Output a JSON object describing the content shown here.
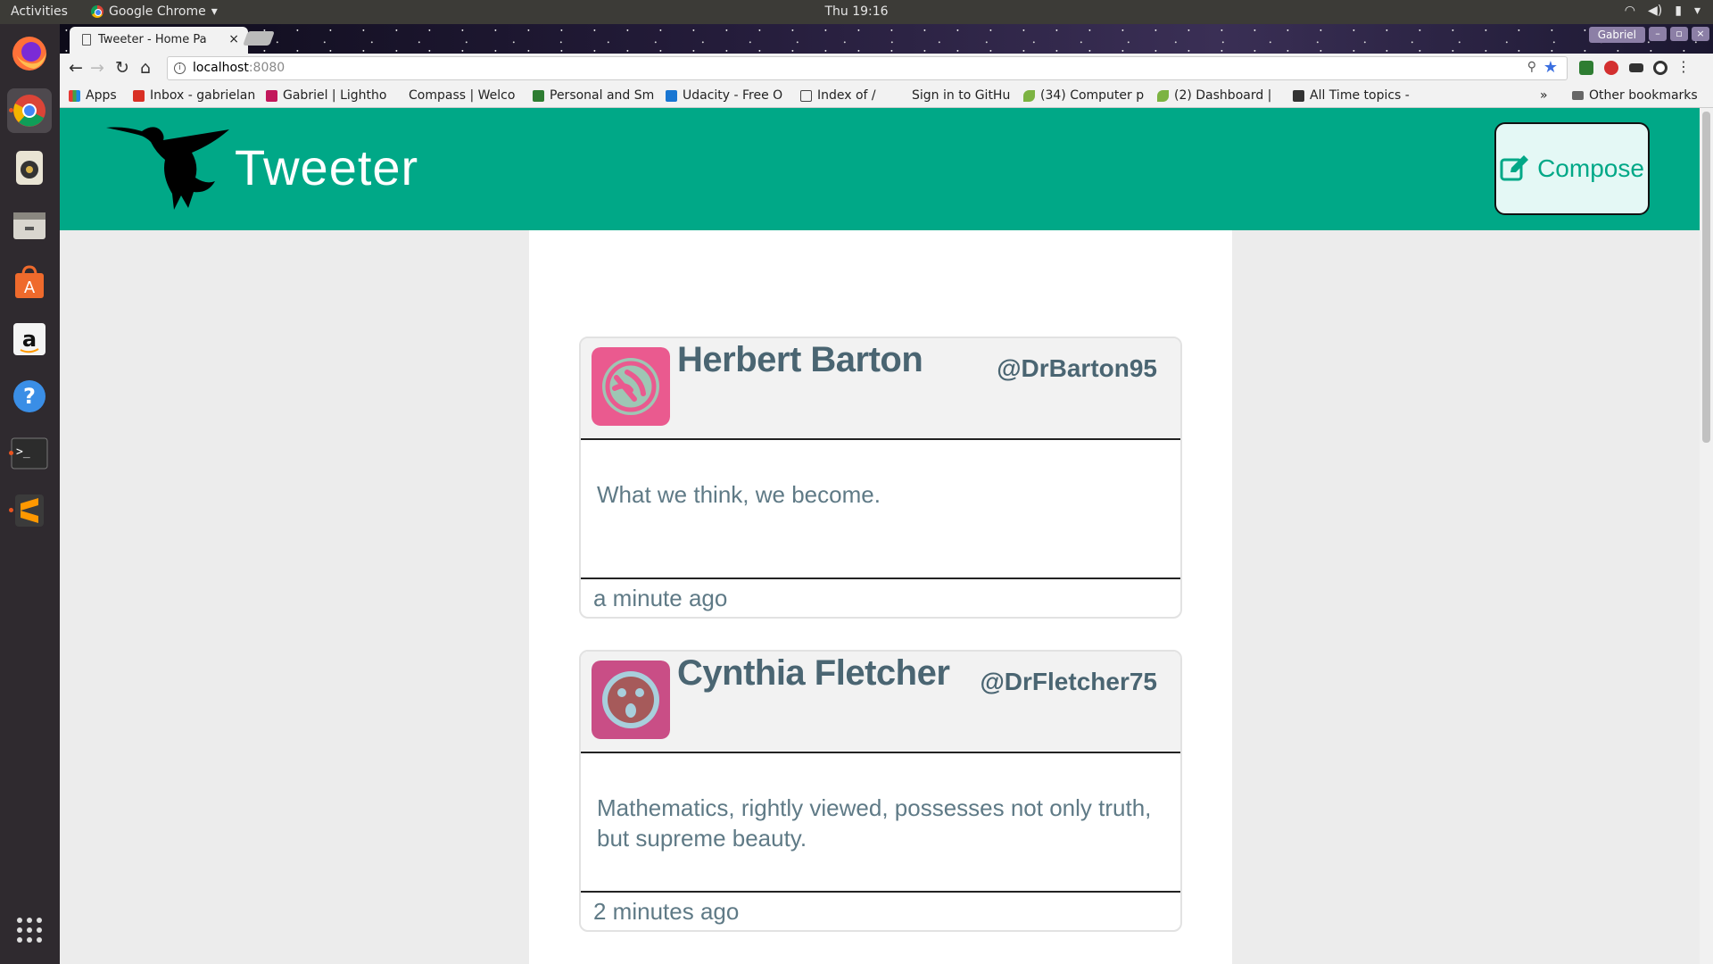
{
  "system": {
    "activities": "Activities",
    "app_name": "Google Chrome",
    "clock": "Thu 19:16"
  },
  "browser": {
    "tab_title": "Tweeter - Home Pa",
    "tab_close": "×",
    "profile": "Gabriel",
    "url_host": "localhost",
    "url_port": ":8080",
    "bookmarks": [
      {
        "label": "Apps",
        "icon": "apps-grid-icon",
        "color": "#e53935"
      },
      {
        "label": "Inbox - gabrielan",
        "icon": "gmail-icon",
        "color": "#d93025"
      },
      {
        "label": "Gabriel | Lightho",
        "icon": "lighthouse-icon",
        "color": "#c2185b"
      },
      {
        "label": "Compass | Welco",
        "icon": "compass-icon",
        "color": "#ffffff"
      },
      {
        "label": "Personal and Sm",
        "icon": "td-bank-icon",
        "color": "#2e7d32"
      },
      {
        "label": "Udacity - Free O",
        "icon": "udacity-icon",
        "color": "#1976d2"
      },
      {
        "label": "Index of /",
        "icon": "file-icon",
        "color": "#ffffff"
      },
      {
        "label": "Sign in to GitHu",
        "icon": "github-icon",
        "color": "#ffffff"
      },
      {
        "label": "(34) Computer p",
        "icon": "leaf-icon",
        "color": "#7cb342"
      },
      {
        "label": "(2) Dashboard | ",
        "icon": "leaf-icon",
        "color": "#7cb342"
      },
      {
        "label": "All Time topics -",
        "icon": "info-icon",
        "color": "#333333"
      }
    ],
    "more_bookmarks": "»",
    "other_bookmarks": "Other bookmarks"
  },
  "app": {
    "brand": "Tweeter",
    "compose_label": "Compose",
    "accent_color": "#00a887"
  },
  "tweets": [
    {
      "name": "Herbert Barton",
      "handle": "@DrBarton95",
      "text": "What we think, we become.",
      "time": "a minute ago",
      "avatar_color": "#ea5a8f"
    },
    {
      "name": "Cynthia Fletcher",
      "handle": "@DrFletcher75",
      "text": "Mathematics, rightly viewed, possesses not only truth, but supreme beauty.",
      "time": "2 minutes ago",
      "avatar_color": "#c94e86"
    }
  ]
}
